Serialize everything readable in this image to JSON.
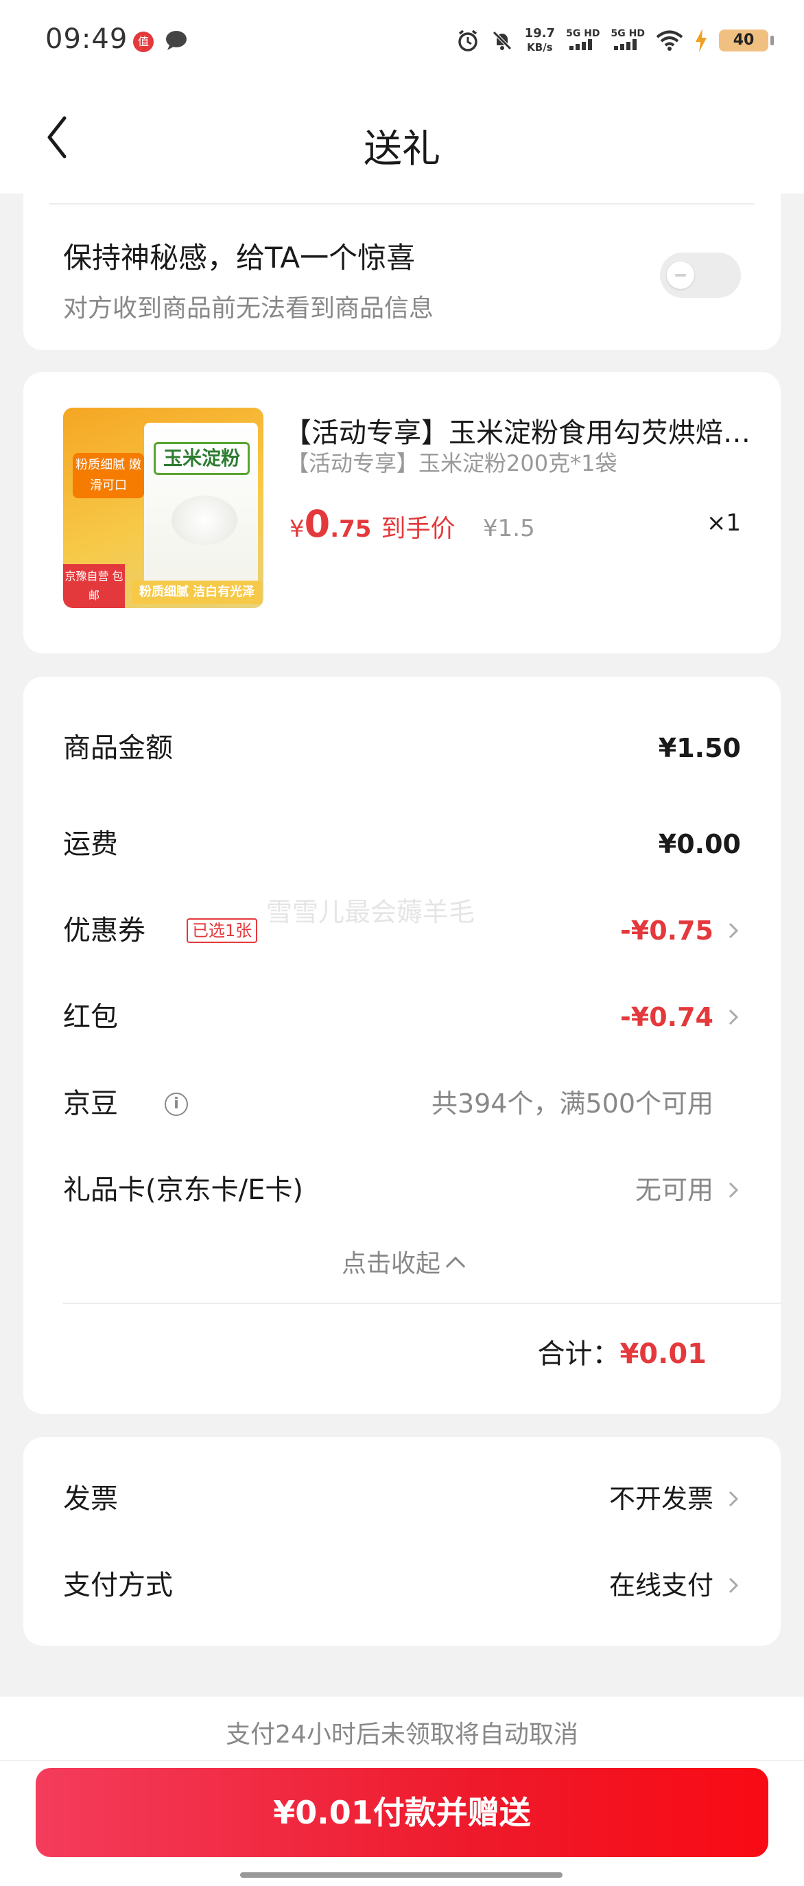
{
  "status_bar": {
    "time": "09:49",
    "badge": "值",
    "net_speed": "19.7",
    "net_unit": "KB/s",
    "signal1": "5G HD",
    "signal2": "5G HD",
    "battery": "40"
  },
  "header": {
    "title": "送礼"
  },
  "mystery": {
    "title": "保持神秘感，给TA一个惊喜",
    "subtitle": "对方收到商品前无法看到商品信息",
    "toggle_on": false
  },
  "product": {
    "image_texts": {
      "bag_label": "玉米淀粉",
      "left_tag": "粉质细腻 嫩滑可口",
      "bottom_tag": "京豫自营 包邮",
      "strip": "粉质细腻 洁白有光泽"
    },
    "title": "【活动专享】玉米淀粉食用勾芡烘焙家用",
    "spec": "【活动专享】玉米淀粉200克*1袋",
    "price_symbol": "¥",
    "price_int": "0",
    "price_dec": ".75",
    "price_label": "到手价",
    "original_price": "¥1.5",
    "quantity": "×1"
  },
  "summary": {
    "goods_label": "商品金额",
    "goods_value": "¥1.50",
    "shipping_label": "运费",
    "shipping_value": "¥0.00",
    "coupon_label": "优惠券",
    "coupon_tag": "已选1张",
    "coupon_value": "-¥0.75",
    "redpacket_label": "红包",
    "redpacket_value": "-¥0.74",
    "jingdou_label": "京豆",
    "jingdou_value": "共394个，满500个可用",
    "giftcard_label": "礼品卡(京东卡/E卡)",
    "giftcard_value": "无可用",
    "collapse_label": "点击收起",
    "total_label": "合计：",
    "total_value": "¥0.01",
    "watermark": "雪雪儿最会薅羊毛"
  },
  "payment": {
    "invoice_label": "发票",
    "invoice_value": "不开发票",
    "method_label": "支付方式",
    "method_value": "在线支付"
  },
  "footer": {
    "notice": "支付24小时后未领取将自动取消",
    "pay_button": "¥0.01付款并赠送"
  },
  "colors": {
    "accent": "#e4393c",
    "background": "#f2f2f2",
    "card": "#ffffff"
  }
}
